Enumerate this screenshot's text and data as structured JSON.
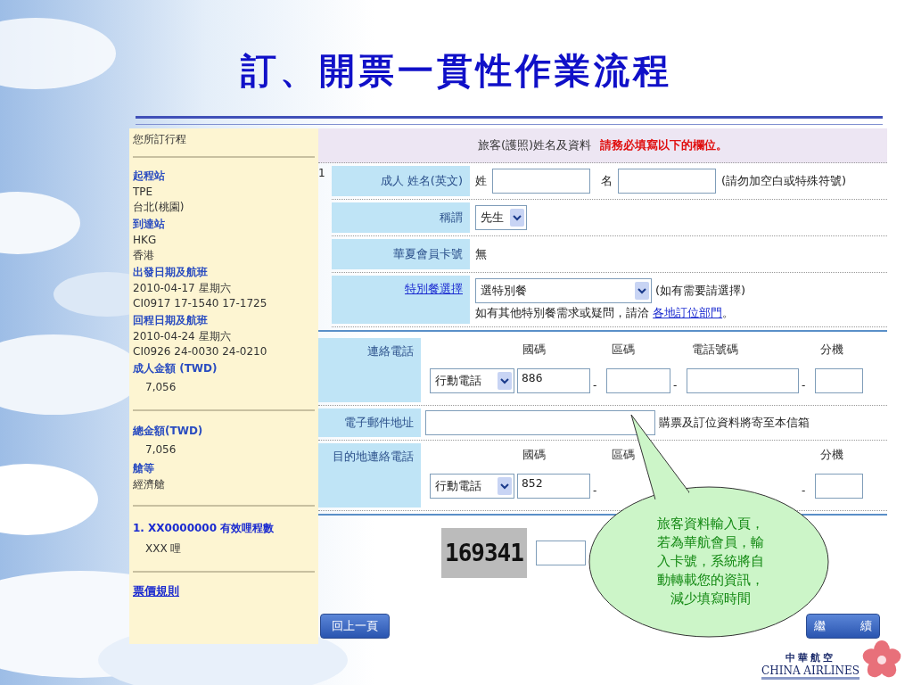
{
  "title": "訂、開票一貫性作業流程",
  "sidebar": {
    "heading": "您所訂行程",
    "sections": [
      {
        "items": [
          {
            "kind": "label",
            "text": "起程站"
          },
          {
            "kind": "value",
            "text": "TPE"
          },
          {
            "kind": "value",
            "text": "台北(桃園)"
          },
          {
            "kind": "label",
            "text": "到達站"
          },
          {
            "kind": "value",
            "text": "HKG"
          },
          {
            "kind": "value",
            "text": "香港"
          },
          {
            "kind": "label",
            "text": "出發日期及航班"
          },
          {
            "kind": "value",
            "text": "2010-04-17 星期六"
          },
          {
            "kind": "value",
            "text": "CI0917 17-1540 17-1725"
          },
          {
            "kind": "label",
            "text": "回程日期及航班"
          },
          {
            "kind": "value",
            "text": "2010-04-24 星期六"
          },
          {
            "kind": "value",
            "text": "CI0926 24-0030 24-0210"
          },
          {
            "kind": "label",
            "text": "成人金額 (TWD)"
          },
          {
            "kind": "amount",
            "text": "7,056"
          }
        ]
      },
      {
        "items": [
          {
            "kind": "label",
            "text": "總金額(TWD)"
          },
          {
            "kind": "amount",
            "text": "7,056"
          },
          {
            "kind": "label",
            "text": "艙等"
          },
          {
            "kind": "value",
            "text": "經濟艙"
          }
        ]
      },
      {
        "items": [
          {
            "kind": "mileage",
            "text": "1. XX0000000 有效哩程數"
          },
          {
            "kind": "amount",
            "text": "XXX 哩"
          }
        ]
      }
    ],
    "link": "票價規則"
  },
  "form": {
    "header": {
      "text": "旅客(護照)姓名及資料",
      "required_note": "請務必填寫以下的欄位。"
    },
    "passenger_number": "1",
    "name_row": {
      "label": "成人 姓名(英文)",
      "surname_label": "姓",
      "given_label": "名",
      "hint": "(請勿加空白或特殊符號)"
    },
    "salutation": {
      "label": "稱謂",
      "value": "先生"
    },
    "member": {
      "label": "華夏會員卡號",
      "value": "無"
    },
    "meal": {
      "label": "特別餐選擇",
      "value": "選特別餐",
      "hint": "(如有需要請選擇)",
      "note": "如有其他特別餐需求或疑問，請洽",
      "note_link": "各地訂位部門",
      "note_end": "。"
    },
    "contact_phone": {
      "label": "連絡電話",
      "type": "行動電話",
      "separator": "-",
      "fields": [
        {
          "kind": "input",
          "label": "國碼",
          "value": "886"
        },
        {
          "kind": "input",
          "label": "區碼"
        },
        {
          "kind": "input",
          "label": "電話號碼"
        },
        {
          "kind": "input",
          "label": "分機"
        }
      ]
    },
    "email": {
      "label": "電子郵件地址",
      "note": "購票及訂位資料將寄至本信箱"
    },
    "destination_phone": {
      "label": "目的地連絡電話",
      "type": "行動電話",
      "separator": "-",
      "fields": [
        {
          "kind": "input",
          "label": "國碼",
          "value": "852"
        },
        {
          "kind": "label",
          "label": "區碼"
        },
        {
          "kind": "blank"
        },
        {
          "kind": "input",
          "label": "分機"
        }
      ]
    },
    "captcha": {
      "code": "169341"
    },
    "back_button": "回上一頁",
    "continue_button": "繼　　　續"
  },
  "callout": {
    "text": "旅客資料輸入頁，若為華航會員，輸入卡號，系統將自動轉載您的資訊，減少填寫時間"
  },
  "logo": {
    "chinese": "中華航空",
    "english": "CHINA AIRLINES"
  }
}
